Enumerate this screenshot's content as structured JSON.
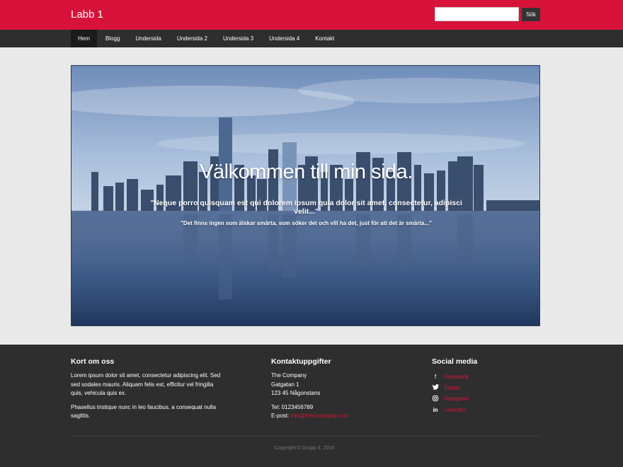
{
  "header": {
    "brand": "Labb 1",
    "search": {
      "value": "",
      "placeholder": "",
      "button_label": "Sök"
    }
  },
  "nav": {
    "items": [
      {
        "label": "Hem",
        "active": true
      },
      {
        "label": "Blogg"
      },
      {
        "label": "Undersida"
      },
      {
        "label": "Undersida 2"
      },
      {
        "label": "Undersida 3"
      },
      {
        "label": "Undersida 4"
      },
      {
        "label": "Kontakt"
      }
    ]
  },
  "hero": {
    "title": "Välkommen till min sida.",
    "quote": "\"Neque porro quisquam est qui dolorem ipsum quia dolor sit amet, consectetur, adipisci velit...\"",
    "subquote": "\"Det finns ingen som älskar smärta, som söker det och vill ha det, just för att det är smärta...\""
  },
  "footer": {
    "about": {
      "heading": "Kort om oss",
      "p1": "Lorem ipsum dolor sit amet, consectetur adipiscing elit. Sed sed sodales mauris. Aliquam felis est, efficitur vel fringilla quis, vehicula quis ex.",
      "p2": "Phasellus tristique nunc in leo faucibus, a consequat nulla sagittis."
    },
    "contact": {
      "heading": "Kontaktuppgifter",
      "company": "The Company",
      "street": "Gatgatan 1",
      "city": "123 45 Någonstans",
      "phone": "Tel: 0123456789",
      "email_label": "E-post: ",
      "email": "info@thecompany.com"
    },
    "social": {
      "heading": "Social media",
      "items": [
        {
          "icon": "facebook-icon",
          "label": "Facebook"
        },
        {
          "icon": "twitter-icon",
          "label": "Twitter"
        },
        {
          "icon": "instagram-icon",
          "label": "Instagram"
        },
        {
          "icon": "linkedin-icon",
          "label": "LinkedIn"
        }
      ]
    },
    "copyright": "Copyright © Grupp X, 2016"
  },
  "colors": {
    "brand_red": "#d8133a",
    "dark": "#2e2e2e",
    "page_bg": "#e9e9e9"
  }
}
